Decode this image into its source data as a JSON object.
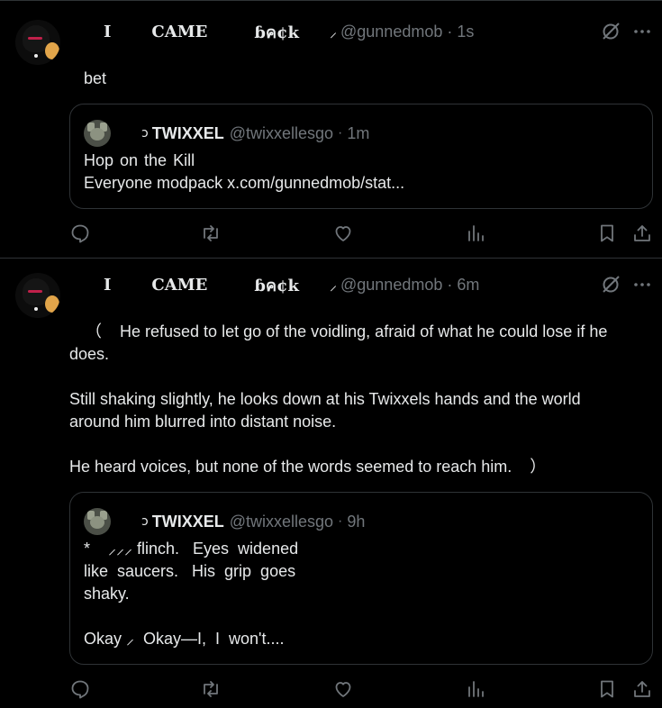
{
  "posts": [
    {
      "author": {
        "name_parts": [
          "I",
          "CAME",
          "ɓค¢k",
          "⸝"
        ],
        "handle": "@gunnedmob",
        "time": "1s"
      },
      "text": "bet",
      "quote": {
        "author": {
          "mark": "ɔ",
          "name": "TWIXXEL",
          "handle": "@twixxellesgo",
          "time": "1m"
        },
        "lines": [
          "Hop  on  the  Kill",
          "Everyone  modpack x.com/gunnedmob/stat..."
        ]
      }
    },
    {
      "author": {
        "name_parts": [
          "I",
          "CAME",
          "ɓค¢k",
          "⸝"
        ],
        "handle": "@gunnedmob",
        "time": "6m"
      },
      "paragraphs": [
        [
          "（    He refused to let go of the voidling, afraid of what he could lose if he",
          "does."
        ],
        [
          "Still shaking slightly, he looks down at his Twixxels hands and the world",
          "around him blurred into distant noise."
        ],
        [
          "He heard voices, but none of the words seemed to reach him.    ）"
        ]
      ],
      "quote": {
        "author": {
          "mark": "ɔ",
          "name": "TWIXXEL",
          "handle": "@twixxellesgo",
          "time": "9h"
        },
        "lines": [
          "*    ⸝⸝⸝ flinch.   Eyes  widened",
          "like  saucers.   His  grip  goes",
          "shaky.",
          "",
          "Okay ⸝  Okay—I,  I  won't...."
        ]
      }
    }
  ],
  "icons": {
    "reply": "reply-icon",
    "repost": "repost-icon",
    "like": "like-icon",
    "views": "views-icon",
    "bookmark": "bookmark-icon",
    "share": "share-icon",
    "grok": "grok-icon",
    "more": "more-icon"
  },
  "colors": {
    "background": "#000000",
    "text": "#e7e9ea",
    "muted": "#71767b",
    "border": "#2f3336"
  }
}
